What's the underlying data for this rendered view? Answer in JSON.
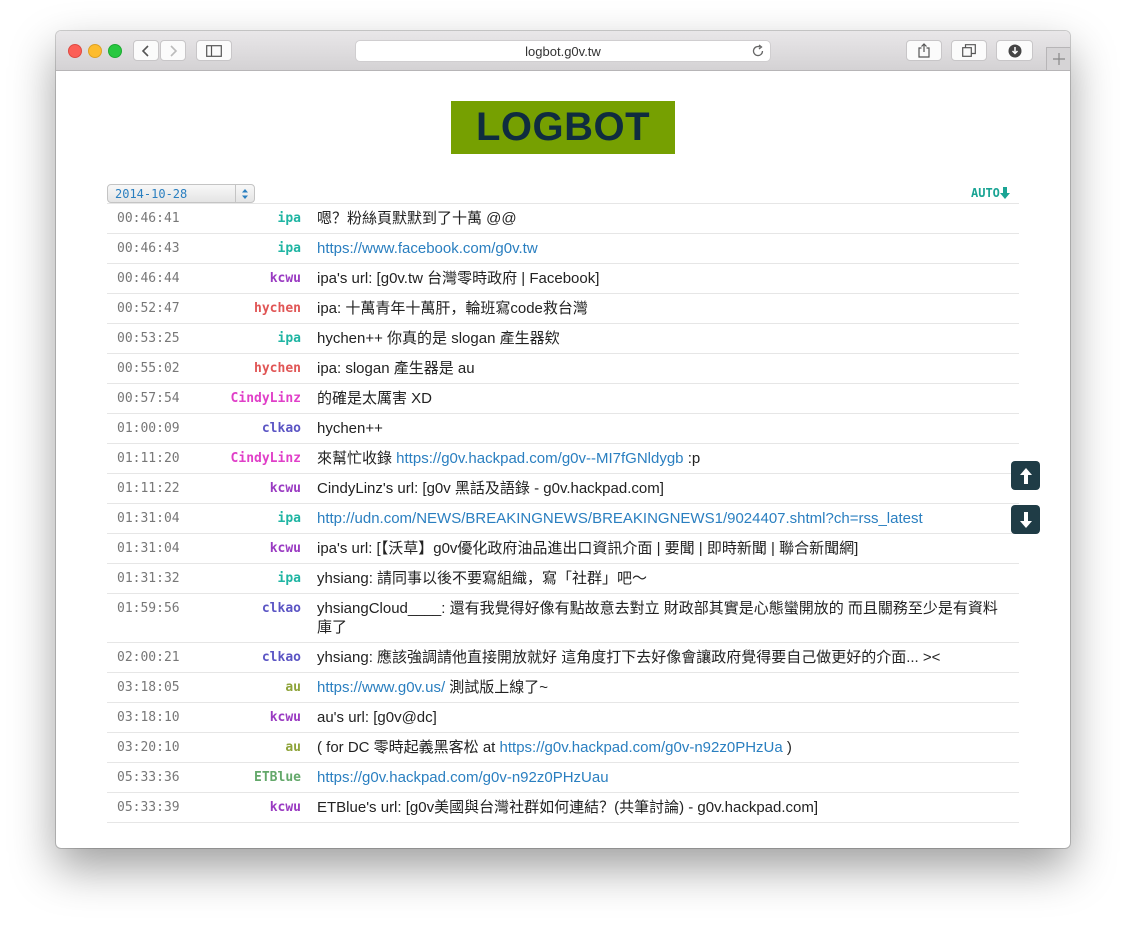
{
  "browser": {
    "url": "logbot.g0v.tw"
  },
  "page": {
    "logo": "LOGBOT",
    "date": "2014-10-28",
    "auto_label": "AUTO"
  },
  "colors": {
    "ipa": "#1fb5a3",
    "kcwu": "#9a3bc2",
    "hychen": "#e05555",
    "CindyLinz": "#e03fc8",
    "clkao": "#5b55c4",
    "au": "#8ea43a",
    "ETBlue": "#63a86a"
  },
  "log": [
    {
      "time": "00:46:41",
      "nick": "ipa",
      "parts": [
        {
          "text": "嗯？粉絲頁默默到了十萬 @@"
        }
      ]
    },
    {
      "time": "00:46:43",
      "nick": "ipa",
      "parts": [
        {
          "text": "https://www.facebook.com/g0v.tw",
          "link": true
        }
      ]
    },
    {
      "time": "00:46:44",
      "nick": "kcwu",
      "parts": [
        {
          "text": "ipa's url: [g0v.tw 台灣零時政府 | Facebook]"
        }
      ]
    },
    {
      "time": "00:52:47",
      "nick": "hychen",
      "parts": [
        {
          "text": "ipa: 十萬青年十萬肝，輪班寫code救台灣"
        }
      ]
    },
    {
      "time": "00:53:25",
      "nick": "ipa",
      "parts": [
        {
          "text": "hychen++ 你真的是 slogan 產生器欸"
        }
      ]
    },
    {
      "time": "00:55:02",
      "nick": "hychen",
      "parts": [
        {
          "text": "ipa: slogan 產生器是 au"
        }
      ]
    },
    {
      "time": "00:57:54",
      "nick": "CindyLinz",
      "parts": [
        {
          "text": "的確是太厲害 XD"
        }
      ]
    },
    {
      "time": "01:00:09",
      "nick": "clkao",
      "parts": [
        {
          "text": "hychen++"
        }
      ]
    },
    {
      "time": "01:11:20",
      "nick": "CindyLinz",
      "parts": [
        {
          "text": "來幫忙收錄 "
        },
        {
          "text": "https://g0v.hackpad.com/g0v--MI7fGNldygb",
          "link": true
        },
        {
          "text": " :p"
        }
      ]
    },
    {
      "time": "01:11:22",
      "nick": "kcwu",
      "parts": [
        {
          "text": "CindyLinz's url: [g0v 黑話及語錄 - g0v.hackpad.com]"
        }
      ]
    },
    {
      "time": "01:31:04",
      "nick": "ipa",
      "parts": [
        {
          "text": "http://udn.com/NEWS/BREAKINGNEWS/BREAKINGNEWS1/9024407.shtml?ch=rss_latest",
          "link": true
        }
      ]
    },
    {
      "time": "01:31:04",
      "nick": "kcwu",
      "parts": [
        {
          "text": "ipa's url: [【沃草】g0v優化政府油品進出口資訊介面 | 要聞 | 即時新聞 | 聯合新聞網]"
        }
      ]
    },
    {
      "time": "01:31:32",
      "nick": "ipa",
      "parts": [
        {
          "text": "yhsiang: 請同事以後不要寫組織，寫「社群」吧～"
        }
      ]
    },
    {
      "time": "01:59:56",
      "nick": "clkao",
      "parts": [
        {
          "text": "yhsiangCloud____: 還有我覺得好像有點故意去對立 財政部其實是心態蠻開放的 而且關務至少是有資料庫了"
        }
      ]
    },
    {
      "time": "02:00:21",
      "nick": "clkao",
      "parts": [
        {
          "text": "yhsiang: 應該強調請他直接開放就好 這角度打下去好像會讓政府覺得要自己做更好的介面... ><"
        }
      ]
    },
    {
      "time": "03:18:05",
      "nick": "au",
      "parts": [
        {
          "text": "https://www.g0v.us/",
          "link": true
        },
        {
          "text": " 測試版上線了~"
        }
      ]
    },
    {
      "time": "03:18:10",
      "nick": "kcwu",
      "parts": [
        {
          "text": "au's url: [g0v@dc]"
        }
      ]
    },
    {
      "time": "03:20:10",
      "nick": "au",
      "parts": [
        {
          "text": "( for DC 零時起義黑客松 at "
        },
        {
          "text": "https://g0v.hackpad.com/g0v-n92z0PHzUa",
          "link": true
        },
        {
          "text": " )"
        }
      ]
    },
    {
      "time": "05:33:36",
      "nick": "ETBlue",
      "parts": [
        {
          "text": "https://g0v.hackpad.com/g0v-n92z0PHzUau",
          "link": true
        }
      ]
    },
    {
      "time": "05:33:39",
      "nick": "kcwu",
      "parts": [
        {
          "text": "ETBlue's url: [g0v美國與台灣社群如何連結？(共筆討論) - g0v.hackpad.com]"
        }
      ]
    }
  ]
}
